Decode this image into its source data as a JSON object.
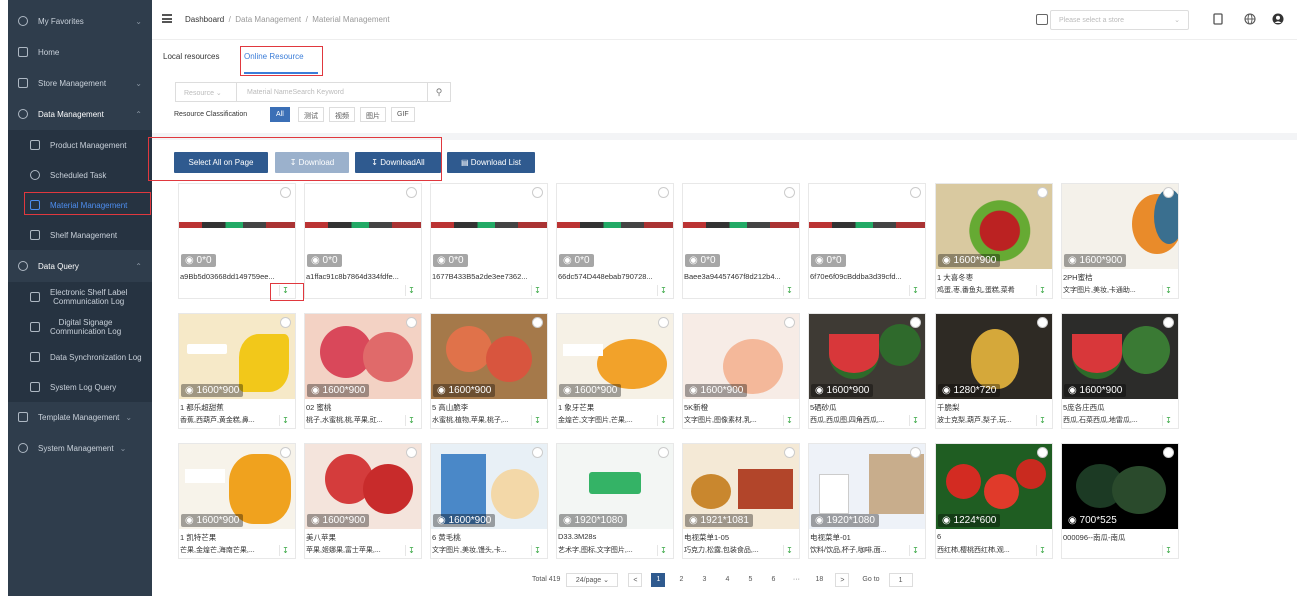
{
  "sidebar": {
    "favorites": "My Favorites",
    "home": "Home",
    "store_mgmt": "Store Management",
    "data_mgmt": "Data Management",
    "product_mgmt": "Product Management",
    "scheduled_task": "Scheduled Task",
    "material_mgmt": "Material Management",
    "shelf_mgmt": "Shelf Management",
    "data_query": "Data Query",
    "esl_log_1": "Electronic Shelf Label",
    "esl_log_2": "Communication Log",
    "signage_log_1": "Digital Signage",
    "signage_log_2": "Communication Log",
    "data_sync_log": "Data Synchronization Log",
    "system_log": "System Log Query",
    "template_mgmt": "Template Management",
    "system_mgmt": "System Management"
  },
  "header": {
    "breadcrumb_root": "Dashboard",
    "breadcrumb_sep1": "/",
    "breadcrumb_mid": "Data Management",
    "breadcrumb_sep2": "/",
    "breadcrumb_leaf": "Material Management",
    "store_placeholder": "Please select a store"
  },
  "tabs": {
    "local": "Local resources",
    "online": "Online Resource"
  },
  "search": {
    "type_select": "Resource",
    "placeholder": "Material NameSearch Keyword",
    "classification_label": "Resource Classification",
    "chips": [
      "All",
      "测试",
      "视频",
      "图片",
      "GIF"
    ]
  },
  "actions": {
    "select_all": "Select All on Page",
    "download": "Download",
    "download_all": "DownloadAll",
    "download_list": "Download List"
  },
  "colors": {
    "accent": "#2f5a8f",
    "sidebar_bg": "#2f3d4c",
    "highlight": "#e0383e",
    "download_icon": "#3aa845"
  },
  "cards": [
    {
      "dim": "0*0",
      "name": "a9Bb5d03668dd149759ee...",
      "tags": "",
      "thumb": "strip"
    },
    {
      "dim": "0*0",
      "name": "a1ffac91c8b7864d334fdfe...",
      "tags": "",
      "thumb": "strip"
    },
    {
      "dim": "0*0",
      "name": "1677B433B5a2de3ee7362...",
      "tags": "",
      "thumb": "strip"
    },
    {
      "dim": "0*0",
      "name": "66dc574D448ebab790728...",
      "tags": "",
      "thumb": "strip"
    },
    {
      "dim": "0*0",
      "name": "Baee3a94457467f8d212b4...",
      "tags": "",
      "thumb": "strip"
    },
    {
      "dim": "0*0",
      "name": "6f70e6f09cBddba3d39cfd...",
      "tags": "",
      "thumb": "strip"
    },
    {
      "dim": "1600*900",
      "name": "1 大喜冬枣",
      "tags": "鸡蛋,枣,番鱼丸,蛋糕,菜肴",
      "thumb": "dates"
    },
    {
      "dim": "1600*900",
      "name": "2PH蜜桔",
      "tags": "文字图片,美妆,卡通助...",
      "thumb": "tangerine"
    },
    {
      "dim": "1600*900",
      "name": "1 都乐超甜蕉",
      "tags": "香蕉,西葫芦,黄金糕,鼻...",
      "thumb": "banana"
    },
    {
      "dim": "1600*900",
      "name": "02 蜜桃",
      "tags": "桃子,水蜜桃,桃,苹果,豇...",
      "thumb": "peach"
    },
    {
      "dim": "1600*900",
      "name": "5 高山脆李",
      "tags": "水蜜桃,植物,苹果,桃子,...",
      "thumb": "plum"
    },
    {
      "dim": "1600*900",
      "name": "1 象牙芒果",
      "tags": "金煌芒,文字图片,芒果,...",
      "thumb": "mango"
    },
    {
      "dim": "1600*900",
      "name": "5K新橙",
      "tags": "文字图片,图像素材,乳...",
      "thumb": "orange"
    },
    {
      "dim": "1600*900",
      "name": "5硒砂瓜",
      "tags": "西瓜,西瓜图,四角西瓜,...",
      "thumb": "watermelon"
    },
    {
      "dim": "1280*720",
      "name": "千脆梨",
      "tags": "波士克梨,葫芦,梨子,玩...",
      "thumb": "pear"
    },
    {
      "dim": "1600*900",
      "name": "5庞各庄西瓜",
      "tags": "西瓜,石菜西瓜,地雷瓜,...",
      "thumb": "watermelon2"
    },
    {
      "dim": "1600*900",
      "name": "1 凯特芒果",
      "tags": "芒果,金煌芒,海南芒果,...",
      "thumb": "mango2"
    },
    {
      "dim": "1600*900",
      "name": "美八苹果",
      "tags": "苹果,姬娜果,富士苹果,...",
      "thumb": "apple"
    },
    {
      "dim": "1600*900",
      "name": "6 黄毛桃",
      "tags": "文字图片,美妆,馒头,卡...",
      "thumb": "yellowpeach"
    },
    {
      "dim": "1920*1080",
      "name": "D33.3M28s",
      "tags": "艺术字,图标,文字图片,...",
      "thumb": "logo"
    },
    {
      "dim": "1921*1081",
      "name": "电视菜单1-05",
      "tags": "巧克力,松露,包装食品,...",
      "thumb": "menu"
    },
    {
      "dim": "1920*1080",
      "name": "电视菜单-01",
      "tags": "饮料/饮品,杯子,咖啡,面...",
      "thumb": "drinks"
    },
    {
      "dim": "1224*600",
      "name": "6",
      "tags": "西红柿,樱桃西红柿,观...",
      "thumb": "tomato"
    },
    {
      "dim": "700*525",
      "name": "000096--南瓜-南瓜",
      "tags": "",
      "thumb": "pumpkin"
    }
  ],
  "pagination": {
    "total": "Total 419",
    "page_size": "24/page",
    "prev": "<",
    "pages": [
      "1",
      "2",
      "3",
      "4",
      "5",
      "6",
      "···",
      "18"
    ],
    "next": ">",
    "goto_label": "Go to",
    "goto_value": "1"
  }
}
